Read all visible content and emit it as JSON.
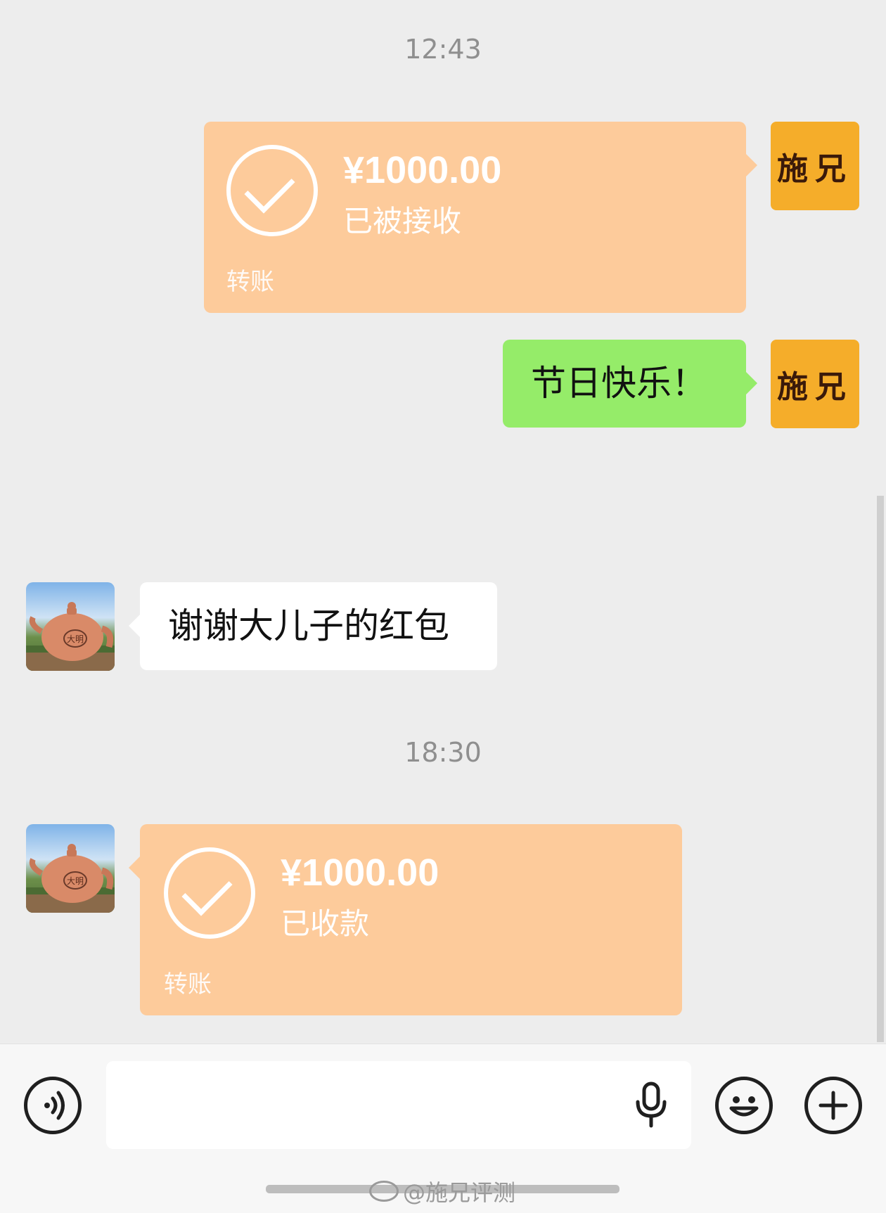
{
  "chat": {
    "time1": "12:43",
    "outgoing_transfer": {
      "amount": "¥1000.00",
      "status": "已被接收",
      "label": "转账"
    },
    "outgoing_avatar_text": "施兄",
    "outgoing_text": "节日快乐！",
    "incoming_text": "谢谢大儿子的红包",
    "teapot_text": "大明",
    "time2": "18:30",
    "incoming_transfer": {
      "amount": "¥1000.00",
      "status": "已收款",
      "label": "转账"
    }
  },
  "input_bar": {
    "voice_icon": "voice-mode-icon",
    "mic_icon": "microphone-icon",
    "emoji_icon": "emoji-icon",
    "plus_icon": "plus-icon"
  },
  "watermark": "@施兄评测",
  "colors": {
    "background": "#ededed",
    "transfer_bubble": "#fdcb9b",
    "outgoing_text_bubble": "#95ec69",
    "incoming_text_bubble": "#ffffff",
    "avatar_bg": "#f5ad2a"
  }
}
